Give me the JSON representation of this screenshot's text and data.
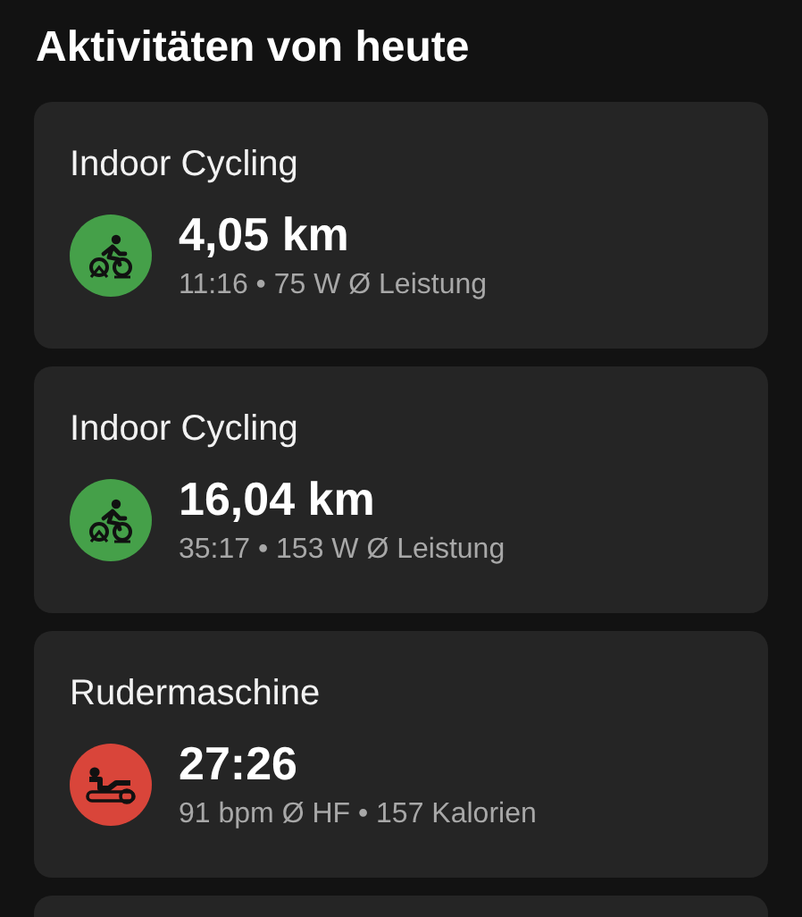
{
  "title": "Aktivitäten von heute",
  "activities": [
    {
      "kind": "cycling",
      "name": "Indoor Cycling",
      "value": "4,05 km",
      "details": "11:16 • 75 W Ø Leistung"
    },
    {
      "kind": "cycling",
      "name": "Indoor Cycling",
      "value": "16,04 km",
      "details": "35:17 • 153 W Ø Leistung"
    },
    {
      "kind": "rowing",
      "name": "Rudermaschine",
      "value": "27:26",
      "details": "91 bpm Ø HF • 157 Kalorien"
    }
  ]
}
